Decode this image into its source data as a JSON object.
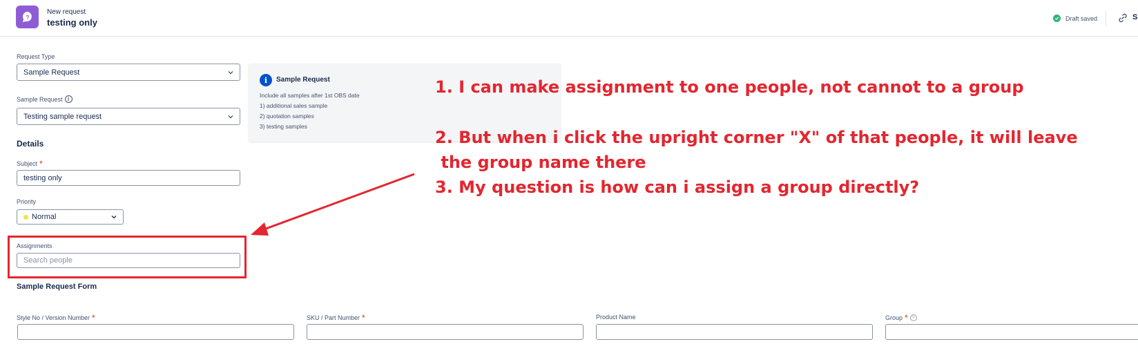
{
  "header": {
    "subtitle": "New request",
    "title": "testing only",
    "draft_status": "Draft saved",
    "cut_text": "Sl"
  },
  "form": {
    "request_type": {
      "label": "Request Type",
      "value": "Sample Request"
    },
    "sample_request": {
      "label": "Sample Request",
      "value": "Testing sample request"
    },
    "details_heading": "Details",
    "subject": {
      "label": "Subject",
      "required_mark": "*",
      "value": "testing only"
    },
    "priority": {
      "label": "Priority",
      "value": "Normal"
    },
    "assignments": {
      "label": "Assignments",
      "placeholder": "Search people"
    },
    "sample_form_heading": "Sample Request Form",
    "columns": [
      {
        "label": "Style No / Version Number",
        "required_mark": "*"
      },
      {
        "label": "SKU / Part Number",
        "required_mark": "*"
      },
      {
        "label": "Product Name"
      },
      {
        "label": "Group",
        "required_mark": "*"
      }
    ]
  },
  "info_panel": {
    "title": "Sample Request",
    "lines": [
      "Include all samples after 1st OBS date",
      "1) additional sales sample",
      "2) quotation samples",
      "3) testing samples"
    ]
  },
  "annotation": {
    "line1": "1. I can make assignment to one people, not cannot to a group",
    "line2": "2. But when i click the upright corner \"X\" of that people, it will leave",
    "line3": " the group name there",
    "line4": "3. My question is how can i assign a group directly?",
    "color": "#e3262f"
  },
  "icons": {
    "logo": "chat-question-icon",
    "draft": "check-circle-icon",
    "link": "link-icon",
    "info": "info-icon",
    "help": "help-icon",
    "chevron": "chevron-down-icon"
  },
  "colors": {
    "logo_bg": "#8e5dd6",
    "draft_check": "#36b37e",
    "info_badge": "#0052cc",
    "required": "#de350b",
    "priority_dot": "#e8e84a"
  }
}
